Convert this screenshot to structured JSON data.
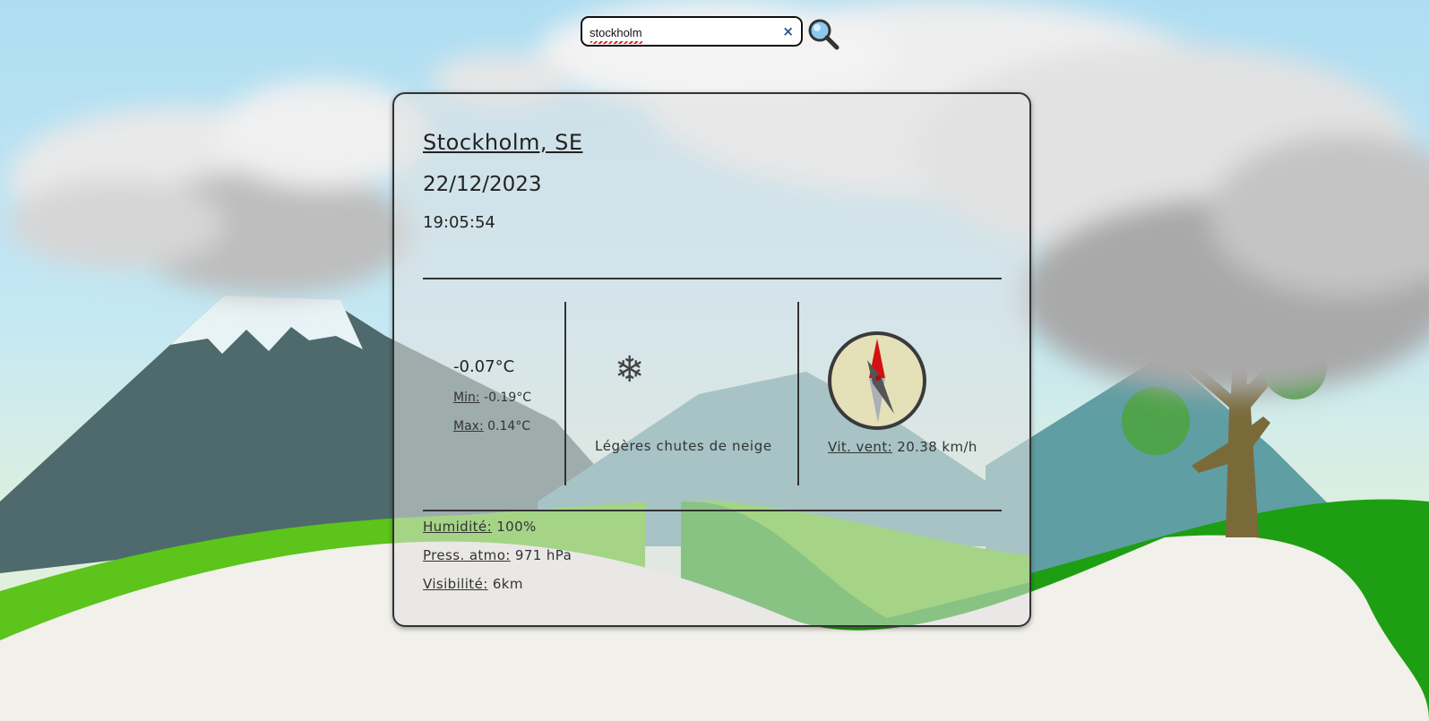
{
  "search": {
    "value": "stockholm",
    "clear_label": "×"
  },
  "weather": {
    "city": "Stockholm, SE",
    "date": "22/12/2023",
    "time": "19:05:54",
    "temperature": "-0.07°C",
    "min_label": "Min:",
    "min_value": "-0.19°C",
    "max_label": "Max:",
    "max_value": "0.14°C",
    "condition_icon": "snowflake-icon",
    "condition_glyph": "❄",
    "description": "Légères chutes de neige",
    "wind_label": "Vit. vent:",
    "wind_value": "20.38 km/h",
    "humidity_label": "Humidité:",
    "humidity_value": "100%",
    "pressure_label": "Press. atmo:",
    "pressure_value": "971 hPa",
    "visibility_label": "Visibilité:",
    "visibility_value": "6km"
  },
  "colors": {
    "compass_face": "#e4e0b8",
    "needle_north": "#d41010",
    "needle_south": "#aab0b6",
    "mountain": "#4e6a6c",
    "grass": "#5cc41a",
    "snow_ground": "#f1f0ea"
  }
}
